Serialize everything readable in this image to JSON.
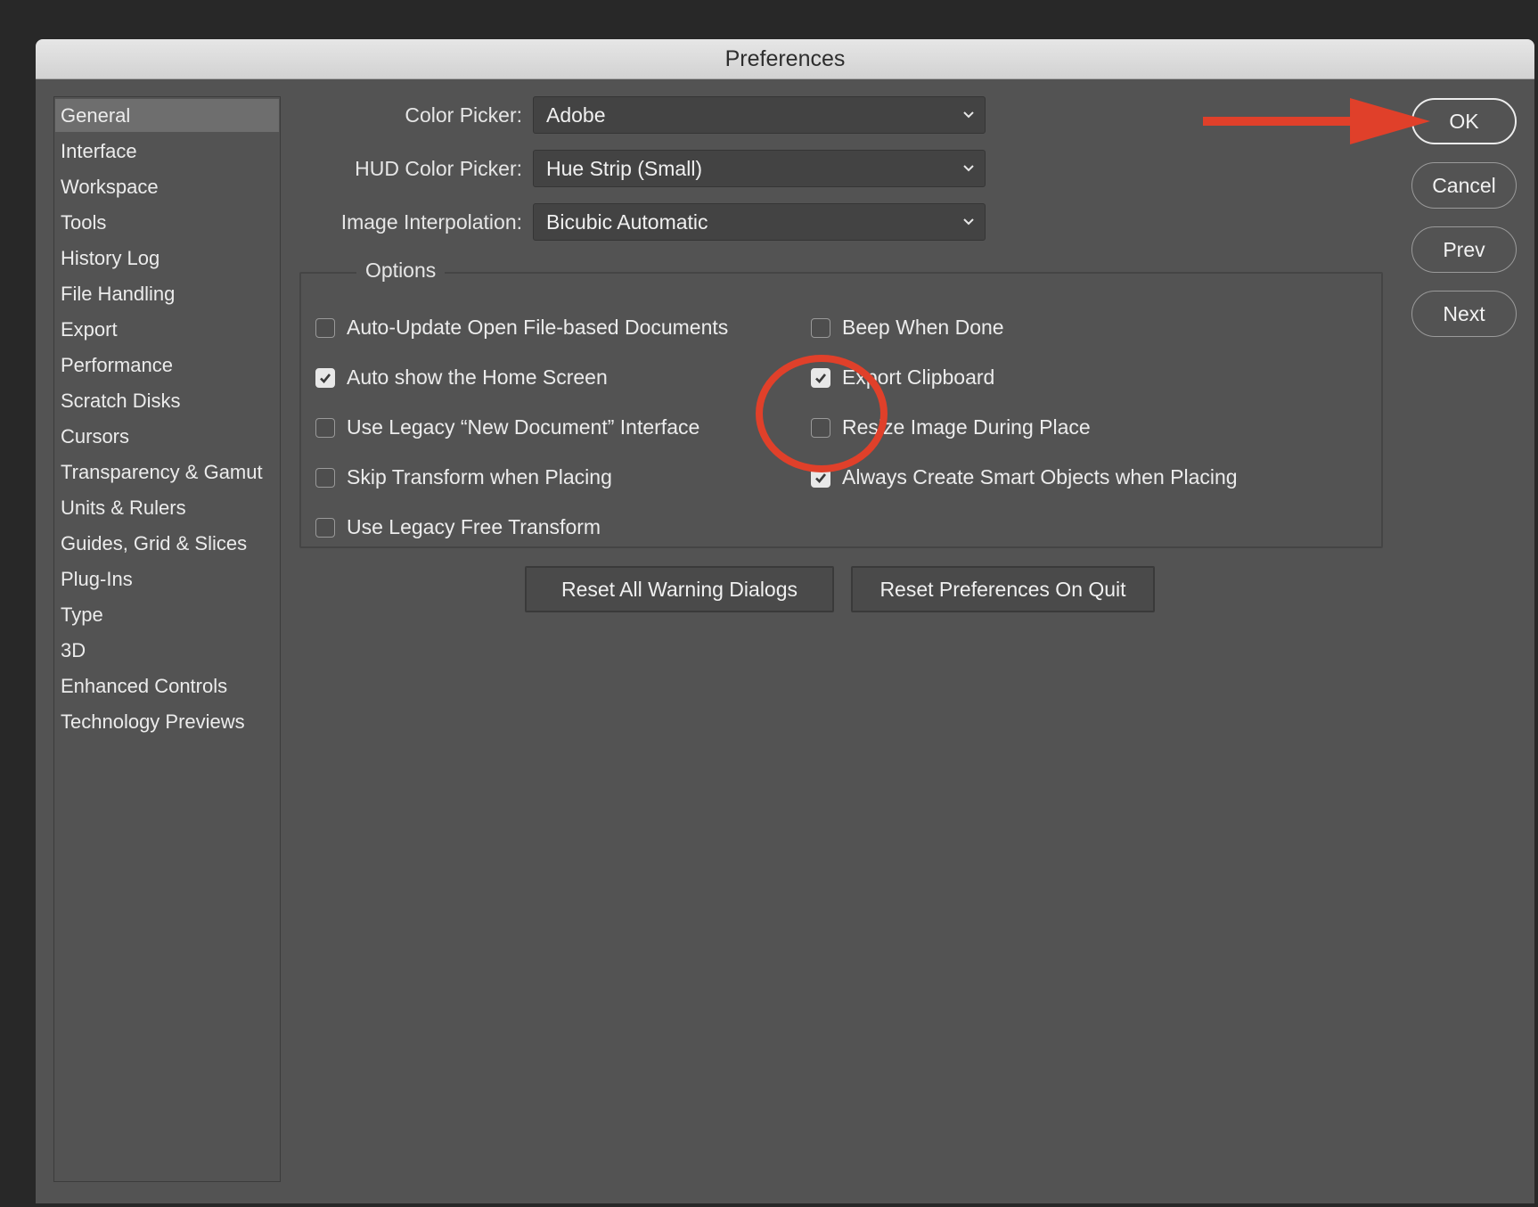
{
  "dialog": {
    "title": "Preferences"
  },
  "sidebar": {
    "items": [
      {
        "label": "General",
        "selected": true
      },
      {
        "label": "Interface"
      },
      {
        "label": "Workspace"
      },
      {
        "label": "Tools"
      },
      {
        "label": "History Log"
      },
      {
        "label": "File Handling"
      },
      {
        "label": "Export"
      },
      {
        "label": "Performance"
      },
      {
        "label": "Scratch Disks"
      },
      {
        "label": "Cursors"
      },
      {
        "label": "Transparency & Gamut"
      },
      {
        "label": "Units & Rulers"
      },
      {
        "label": "Guides, Grid & Slices"
      },
      {
        "label": "Plug-Ins"
      },
      {
        "label": "Type"
      },
      {
        "label": "3D"
      },
      {
        "label": "Enhanced Controls"
      },
      {
        "label": "Technology Previews"
      }
    ]
  },
  "fields": {
    "color_picker": {
      "label": "Color Picker:",
      "value": "Adobe"
    },
    "hud_color_picker": {
      "label": "HUD Color Picker:",
      "value": "Hue Strip (Small)"
    },
    "image_interpolation": {
      "label": "Image Interpolation:",
      "value": "Bicubic Automatic"
    }
  },
  "options": {
    "legend": "Options",
    "left": [
      {
        "label": "Auto-Update Open File-based Documents",
        "checked": false
      },
      {
        "label": "Auto show the Home Screen",
        "checked": true
      },
      {
        "label": "Use Legacy “New Document” Interface",
        "checked": false
      },
      {
        "label": "Skip Transform when Placing",
        "checked": false
      },
      {
        "label": "Use Legacy Free Transform",
        "checked": false
      }
    ],
    "right": [
      {
        "label": "Beep When Done",
        "checked": false
      },
      {
        "label": "Export Clipboard",
        "checked": true
      },
      {
        "label": "Resize Image During Place",
        "checked": false
      },
      {
        "label": "Always Create Smart Objects when Placing",
        "checked": true
      }
    ]
  },
  "reset_buttons": {
    "reset_warnings": "Reset All Warning Dialogs",
    "reset_prefs": "Reset Preferences On Quit"
  },
  "action_buttons": {
    "ok": "OK",
    "cancel": "Cancel",
    "prev": "Prev",
    "next": "Next"
  },
  "colors": {
    "dialog_bg": "#535353",
    "annotation_red": "#e0402a"
  }
}
